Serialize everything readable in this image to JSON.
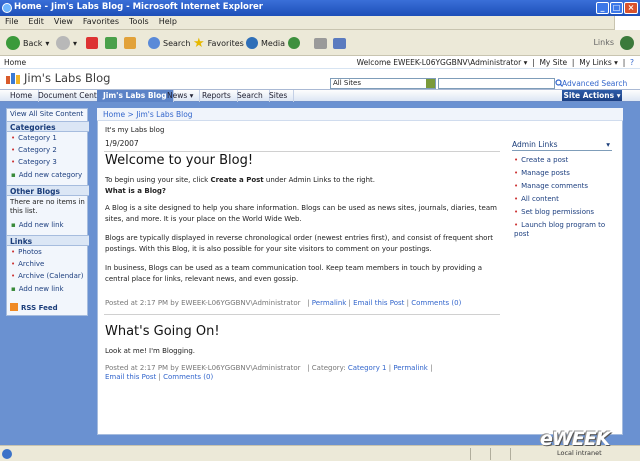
{
  "window": {
    "title": "Home - Jim's Labs Blog - Microsoft Internet Explorer"
  },
  "menu": [
    "File",
    "Edit",
    "View",
    "Favorites",
    "Tools",
    "Help"
  ],
  "toolbar": {
    "back": "Back",
    "search": "Search",
    "favorites": "Favorites",
    "media": "Media",
    "links": "Links"
  },
  "welcome": {
    "home": "Home",
    "user": "Welcome EWEEK-L06YGGBNV\\Administrator",
    "mysite": "My Site",
    "mylinks": "My Links"
  },
  "header": {
    "site_title": "Jim's Labs Blog",
    "search_scope": "All Sites",
    "advanced_search": "Advanced Search",
    "site_actions": "Site Actions"
  },
  "nav": {
    "tabs": [
      "Home",
      "Document Center",
      "Jim's Labs Blog",
      "News",
      "Reports",
      "Search",
      "Sites"
    ]
  },
  "leftnav": {
    "view_all": "View All Site Content",
    "categories_head": "Categories",
    "categories": [
      "Category 1",
      "Category 2",
      "Category 3"
    ],
    "add_category": "Add new category",
    "other_blogs_head": "Other Blogs",
    "other_blogs_text": "There are no items in this list.",
    "add_link": "Add new link",
    "links_head": "Links",
    "links": [
      "Photos",
      "Archive",
      "Archive (Calendar)"
    ],
    "add_link2": "Add new link",
    "rss": "RSS Feed"
  },
  "main": {
    "breadcrumb": "Home > Jim's Labs Blog",
    "tagline": "It's my Labs blog",
    "date": "1/9/2007",
    "post1": {
      "title": "Welcome to your Blog!",
      "intro_a": "To begin using your site, click ",
      "intro_b": "Create a Post",
      "intro_c": " under Admin Links to the right.",
      "q": "What is a Blog?",
      "p1": "A Blog is a site designed to help you share information. Blogs can be used as news sites, journals, diaries, team sites, and more. It is your place on the World Wide Web.",
      "p2": "Blogs are typically displayed in reverse chronological order (newest entries first), and consist of frequent short postings. With this Blog, it is also possible for your site visitors to comment on your postings.",
      "p3": "In business, Blogs can be used as a team communication tool. Keep team members in touch by providing a central place for links, relevant news, and even gossip.",
      "meta": "Posted at 2:17 PM by EWEEK-L06YGGBNV\\Administrator",
      "permalink": "Permalink",
      "email": "Email this Post",
      "comments": "Comments (0)"
    },
    "post2": {
      "title": "What's Going On!",
      "body": "Look at me! I'm Blogging.",
      "meta": "Posted at 2:17 PM by EWEEK-L06YGGBNV\\Administrator",
      "category_label": "Category:",
      "category": "Category 1",
      "permalink": "Permalink",
      "email": "Email this Post",
      "comments": "Comments (0)"
    }
  },
  "admin": {
    "head": "Admin Links",
    "items": [
      "Create a post",
      "Manage posts",
      "Manage comments",
      "All content",
      "Set blog permissions",
      "Launch blog program to post"
    ]
  },
  "status": {
    "zone": "Local intranet",
    "watermark": "eWEEK"
  }
}
